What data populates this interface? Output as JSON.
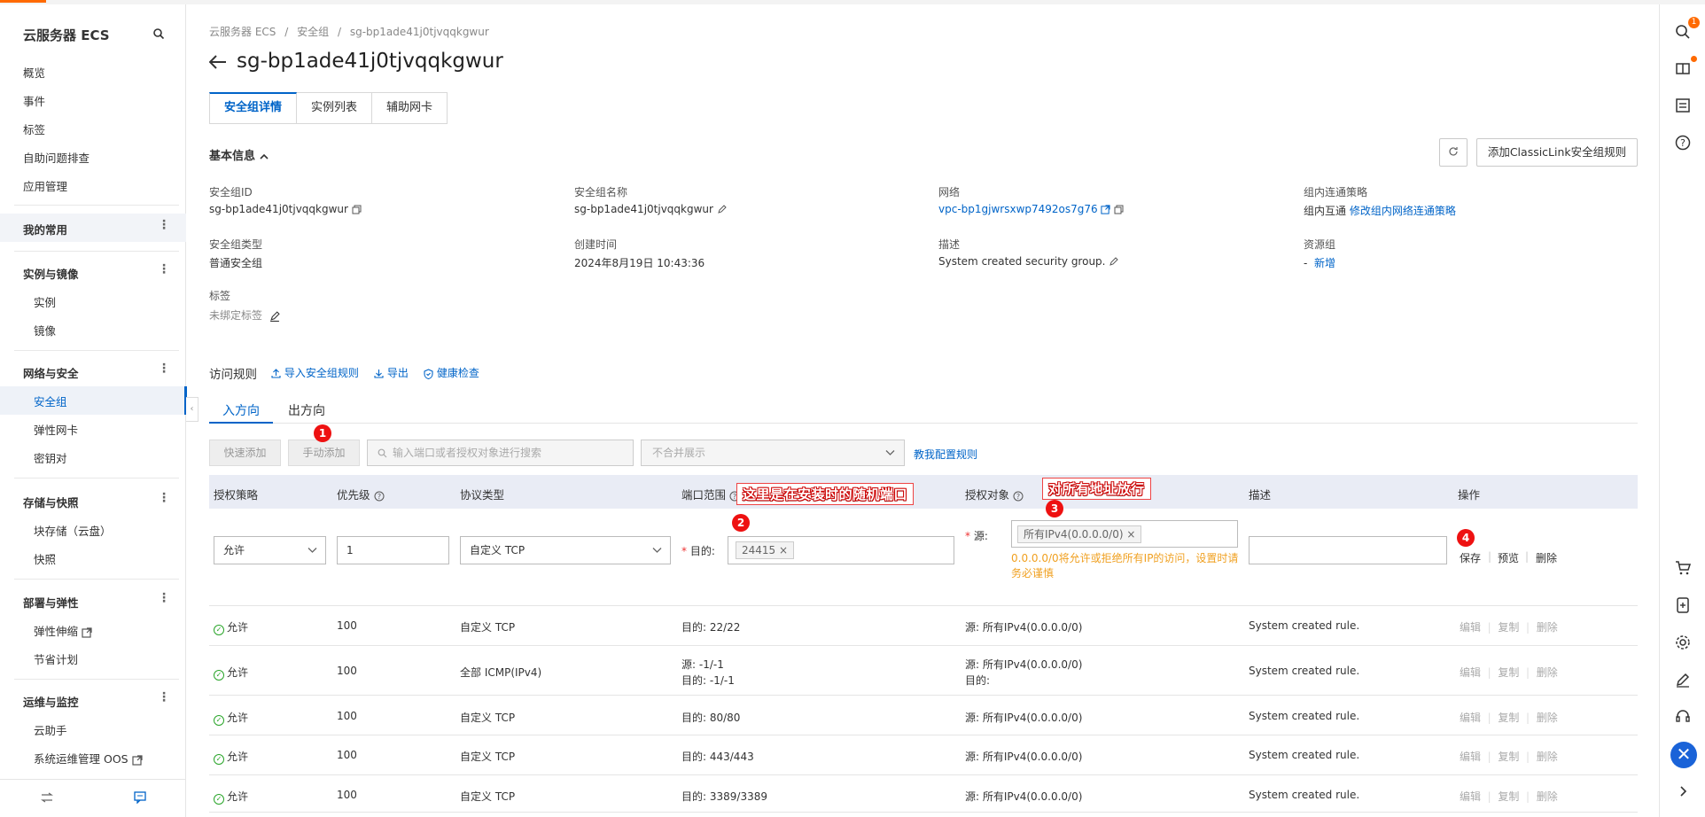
{
  "sidebar": {
    "title": "云服务器 ECS",
    "top_items": [
      "概览",
      "事件",
      "标签",
      "自助问题排查",
      "应用管理"
    ],
    "favorites": "我的常用",
    "groups": [
      {
        "label": "实例与镜像",
        "items": [
          "实例",
          "镜像"
        ]
      },
      {
        "label": "网络与安全",
        "items": [
          "安全组",
          "弹性网卡",
          "密钥对"
        ]
      },
      {
        "label": "存储与快照",
        "items": [
          "块存储（云盘）",
          "快照"
        ]
      },
      {
        "label": "部署与弹性",
        "items": [
          "弹性伸缩",
          "节省计划"
        ]
      },
      {
        "label": "运维与监控",
        "items": [
          "云助手",
          "系统运维管理 OOS"
        ]
      }
    ]
  },
  "breadcrumb": [
    "云服务器 ECS",
    "/",
    "安全组",
    "/",
    "sg-bp1ade41j0tjvqqkgwur"
  ],
  "page_title": "sg-bp1ade41j0tjvqqkgwur",
  "tabs": [
    "安全组详情",
    "实例列表",
    "辅助网卡"
  ],
  "basic_info": {
    "title": "基本信息",
    "add_classiclink": "添加ClassicLink安全组规则",
    "fields": {
      "sg_id_label": "安全组ID",
      "sg_id": "sg-bp1ade41j0tjvqqkgwur",
      "sg_name_label": "安全组名称",
      "sg_name": "sg-bp1ade41j0tjvqqkgwur",
      "network_label": "网络",
      "network": "vpc-bp1gjwrsxwp7492os7g76",
      "intra_label": "组内连通策略",
      "intra": "组内互通",
      "intra_link": "修改组内网络连通策略",
      "type_label": "安全组类型",
      "type": "普通安全组",
      "created_label": "创建时间",
      "created": "2024年8月19日 10:43:36",
      "desc_label": "描述",
      "desc": "System created security group.",
      "rg_label": "资源组",
      "rg": "-",
      "rg_link": "新增",
      "tags_label": "标签",
      "tags": "未绑定标签"
    }
  },
  "access_rules": {
    "title": "访问规则",
    "import": "导入安全组规则",
    "export": "导出",
    "health": "健康检查",
    "dir_in": "入方向",
    "dir_out": "出方向",
    "quick_add": "快速添加",
    "manual_add": "手动添加",
    "search_placeholder": "输入端口或者授权对象进行搜索",
    "merge_select": "不合并展示",
    "teach": "教我配置规则"
  },
  "table": {
    "headers": [
      "授权策略",
      "优先级",
      "协议类型",
      "端口范围",
      "授权对象",
      "描述",
      "操作"
    ],
    "edit_row": {
      "policy": "允许",
      "priority": "1",
      "protocol": "自定义 TCP",
      "dest_label": "目的:",
      "port_chip": "24415",
      "src_label": "源:",
      "src_chip": "所有IPv4(0.0.0.0/0)",
      "warning": "0.0.0.0/0将允许或拒绝所有IP的访问，设置时请务必谨慎",
      "save": "保存",
      "preview": "预览",
      "delete": "删除"
    },
    "rows": [
      {
        "policy": "允许",
        "priority": "100",
        "protocol": "自定义 TCP",
        "port1": "目的: 22/22",
        "port2": "",
        "src1": "源: 所有IPv4(0.0.0.0/0)",
        "src2": "",
        "desc": "System created rule."
      },
      {
        "policy": "允许",
        "priority": "100",
        "protocol": "全部 ICMP(IPv4)",
        "port1": "源: -1/-1",
        "port2": "目的: -1/-1",
        "src1": "源: 所有IPv4(0.0.0.0/0)",
        "src2": "目的:",
        "desc": "System created rule."
      },
      {
        "policy": "允许",
        "priority": "100",
        "protocol": "自定义 TCP",
        "port1": "目的: 80/80",
        "port2": "",
        "src1": "源: 所有IPv4(0.0.0.0/0)",
        "src2": "",
        "desc": "System created rule."
      },
      {
        "policy": "允许",
        "priority": "100",
        "protocol": "自定义 TCP",
        "port1": "目的: 443/443",
        "port2": "",
        "src1": "源: 所有IPv4(0.0.0.0/0)",
        "src2": "",
        "desc": "System created rule."
      },
      {
        "policy": "允许",
        "priority": "100",
        "protocol": "自定义 TCP",
        "port1": "目的: 3389/3389",
        "port2": "",
        "src1": "源: 所有IPv4(0.0.0.0/0)",
        "src2": "",
        "desc": "System created rule."
      }
    ],
    "row_actions": [
      "编辑",
      "|",
      "复制",
      "|",
      "删除"
    ]
  },
  "annotations": {
    "b1": "1",
    "b2": "2",
    "b3": "3",
    "b4": "4",
    "port_note": "这里是在安装时的随机端口",
    "src_note": "对所有地址放行"
  },
  "rail": {
    "notif_count": "1"
  },
  "colors": {
    "accent": "#0064c8",
    "brand": "#ff6a00",
    "annotation": "#e11111",
    "success": "#2aa52a"
  }
}
